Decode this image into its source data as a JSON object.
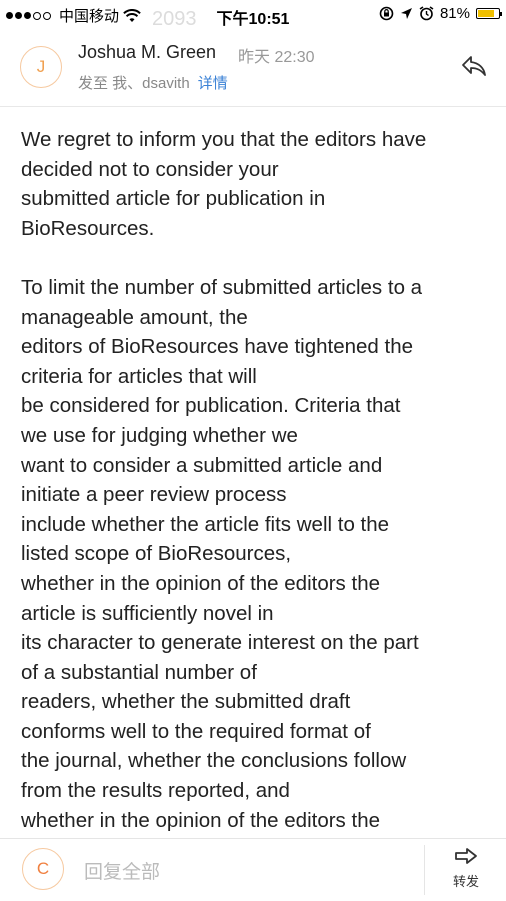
{
  "status_bar": {
    "carrier": "中国移动",
    "time": "下午10:51",
    "battery": "81%",
    "battery_level": 0.81,
    "ghost_text": "2093"
  },
  "header": {
    "avatar_letter": "J",
    "sender": "Joshua M. Green",
    "date": "昨天 22:30",
    "recipients": "发至 我、dsavith",
    "details_link": "详情"
  },
  "body": {
    "paragraphs": [
      "We regret to inform you that the editors have\ndecided not to consider your\nsubmitted article for publication in\nBioResources.",
      "To limit the number of submitted articles to a\nmanageable amount, the\neditors of BioResources have tightened the\ncriteria for articles that will\nbe considered for publication. Criteria that\nwe use for judging whether we\nwant to consider a submitted article and\ninitiate a peer review process\ninclude whether the article fits well to the\nlisted scope of BioResources,\nwhether in the opinion of the editors the\narticle is sufficiently novel in\nits character to generate interest on the part\nof a substantial number of\nreaders, whether the submitted draft\nconforms well to the required format of\nthe journal, whether the conclusions follow\nfrom the results reported, and\nwhether in the opinion of the editors the"
    ]
  },
  "footer": {
    "avatar_letter": "C",
    "reply_all_placeholder": "回复全部",
    "forward_label": "转发"
  }
}
